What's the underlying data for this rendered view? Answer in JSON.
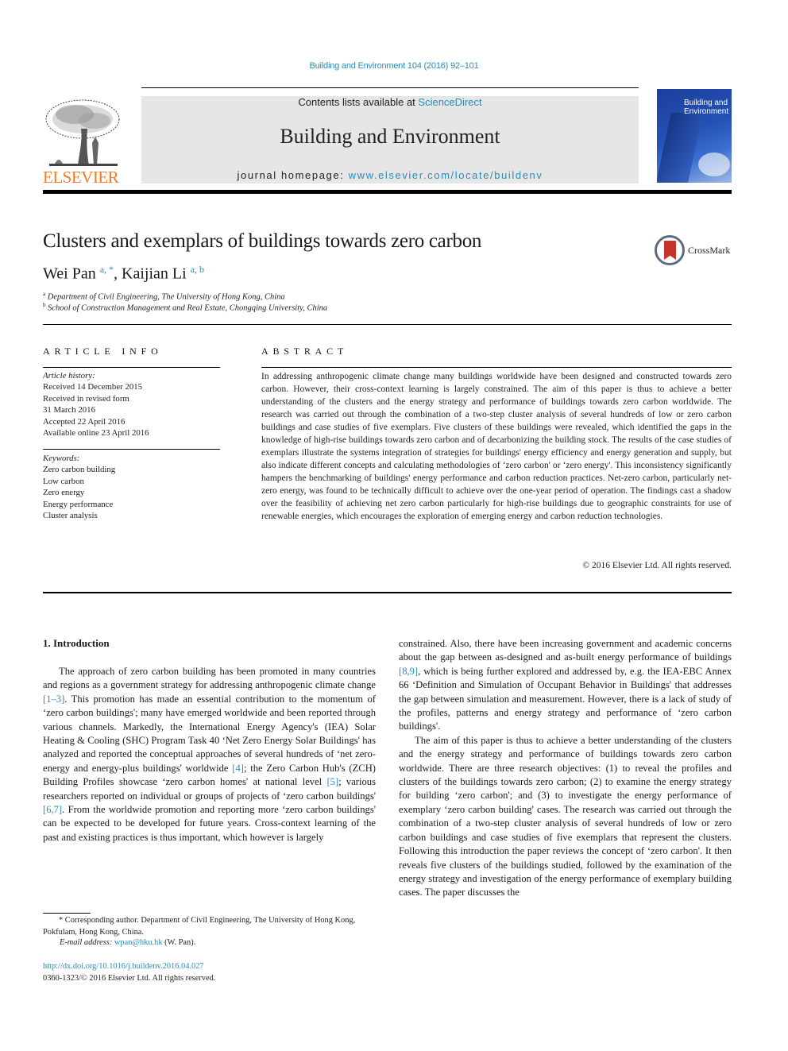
{
  "journal_ref": "Building and Environment 104 (2016) 92–101",
  "masthead": {
    "contents_prefix": "Contents lists available at ",
    "contents_link": "ScienceDirect",
    "journal_name": "Building and Environment",
    "homepage_prefix": "journal homepage: ",
    "homepage_link": "www.elsevier.com/locate/buildenv"
  },
  "publisher_logo": {
    "wordmark": "ELSEVIER",
    "color": "#f47b20"
  },
  "cover": {
    "title_line1": "Building and",
    "title_line2": "Environment"
  },
  "crossmark_label": "CrossMark",
  "article": {
    "title": "Clusters and exemplars of buildings towards zero carbon",
    "authors": [
      {
        "name": "Wei Pan",
        "sup": "a, *"
      },
      {
        "name": "Kaijian Li",
        "sup": "a, b"
      }
    ],
    "affiliations": [
      {
        "key": "a",
        "text": "Department of Civil Engineering, The University of Hong Kong, China"
      },
      {
        "key": "b",
        "text": "School of Construction Management and Real Estate, Chongqing University, China"
      }
    ]
  },
  "article_info": {
    "heading": "ARTICLE INFO",
    "history_label": "Article history:",
    "history": [
      "Received 14 December 2015",
      "Received in revised form",
      "31 March 2016",
      "Accepted 22 April 2016",
      "Available online 23 April 2016"
    ],
    "keywords_label": "Keywords:",
    "keywords": [
      "Zero carbon building",
      "Low carbon",
      "Zero energy",
      "Energy performance",
      "Cluster analysis"
    ]
  },
  "abstract": {
    "heading": "ABSTRACT",
    "text": "In addressing anthropogenic climate change many buildings worldwide have been designed and con­structed towards zero carbon. However, their cross-context learning is largely constrained. The aim of this paper is thus to achieve a better understanding of the clusters and the energy strategy and per­formance of buildings towards zero carbon worldwide. The research was carried out through the com­bination of a two-step cluster analysis of several hundreds of low or zero carbon buildings and case studies of five exemplars. Five clusters of these buildings were revealed, which identified the gaps in the knowledge of high-rise buildings towards zero carbon and of decarbonizing the building stock. The results of the case studies of exemplars illustrate the systems integration of strategies for buildings' energy efficiency and energy generation and supply, but also indicate different concepts and calculating methodologies of ‘zero carbon' or ‘zero energy'. This inconsistency significantly hampers the bench­marking of buildings' energy performance and carbon reduction practices. Net-zero carbon, particularly net-zero energy, was found to be technically difficult to achieve over the one-year period of operation. The findings cast a shadow over the feasibility of achieving net zero carbon particularly for high-rise buildings due to geographic constraints for use of renewable energies, which encourages the explora­tion of emerging energy and carbon reduction technologies.",
    "copyright": "© 2016 Elsevier Ltd. All rights reserved."
  },
  "introduction": {
    "heading": "1.  Introduction",
    "left_p1_a": "The approach of zero carbon building has been promoted in many countries and regions as a government strategy for addressing anthropogenic climate change ",
    "left_cite1": "[1–3]",
    "left_p1_b": ". This promotion has made an essential contribution to the momentum of ‘zero carbon buildings'; many have emerged worldwide and been re­ported through various channels. Markedly, the International En­ergy Agency's (IEA) Solar Heating & Cooling (SHC) Program Task 40 ‘Net Zero Energy Solar Buildings' has analyzed and reported the conceptual approaches of several hundreds of ‘net zero-energy and energy-plus buildings' worldwide ",
    "left_cite2": "[4]",
    "left_p1_c": "; the Zero Carbon Hub's (ZCH) Building Profiles showcase ‘zero carbon homes' at national level ",
    "left_cite3": "[5]",
    "left_p1_d": "; various researchers reported on individual or groups of projects of ‘zero carbon buildings' ",
    "left_cite4": "[6,7]",
    "left_p1_e": ". From the worldwide promotion and reporting more ‘zero carbon buildings' can be expected to be developed for future years. Cross-context learning of the past and existing practices is thus important, which however is largely",
    "right_p1_a": "constrained. Also, there have been increasing government and ac­ademic concerns about the gap between as-designed and as-built energy performance of buildings ",
    "right_cite1": "[8,9]",
    "right_p1_b": ", which is being further explored and addressed by, e.g. the IEA-EBC Annex 66 ‘Definition and Simulation of Occupant Behavior in Buildings' that addresses the gap between simulation and measurement. However, there is a lack of study of the profiles, patterns and energy strategy and performance of ‘zero carbon buildings'.",
    "right_p2": "The aim of this paper is thus to achieve a better understanding of the clusters and the energy strategy and performance of build­ings towards zero carbon worldwide. There are three research ob­jectives: (1) to reveal the profiles and clusters of the buildings towards zero carbon; (2) to examine the energy strategy for building ‘zero carbon'; and (3) to investigate the energy perfor­mance of exemplary ‘zero carbon building' cases. The research was carried out through the combination of a two-step cluster analysis of several hundreds of low or zero carbon buildings and case studies of five exemplars that represent the clusters. Following this introduction the paper reviews the concept of ‘zero carbon'. It then reveals five clusters of the buildings studied, followed by the ex­amination of the energy strategy and investigation of the energy performance of exemplary building cases. The paper discusses the"
  },
  "footnotes": {
    "corresponding": "* Corresponding author. Department of Civil Engineering, The University of Hong Kong, Pokfulam, Hong Kong, China.",
    "email_label": "E-mail address: ",
    "email": "wpan@hku.hk",
    "email_suffix": " (W. Pan).",
    "doi": "http://dx.doi.org/10.1016/j.buildenv.2016.04.027",
    "issn": "0360-1323/© 2016 Elsevier Ltd. All rights reserved."
  }
}
